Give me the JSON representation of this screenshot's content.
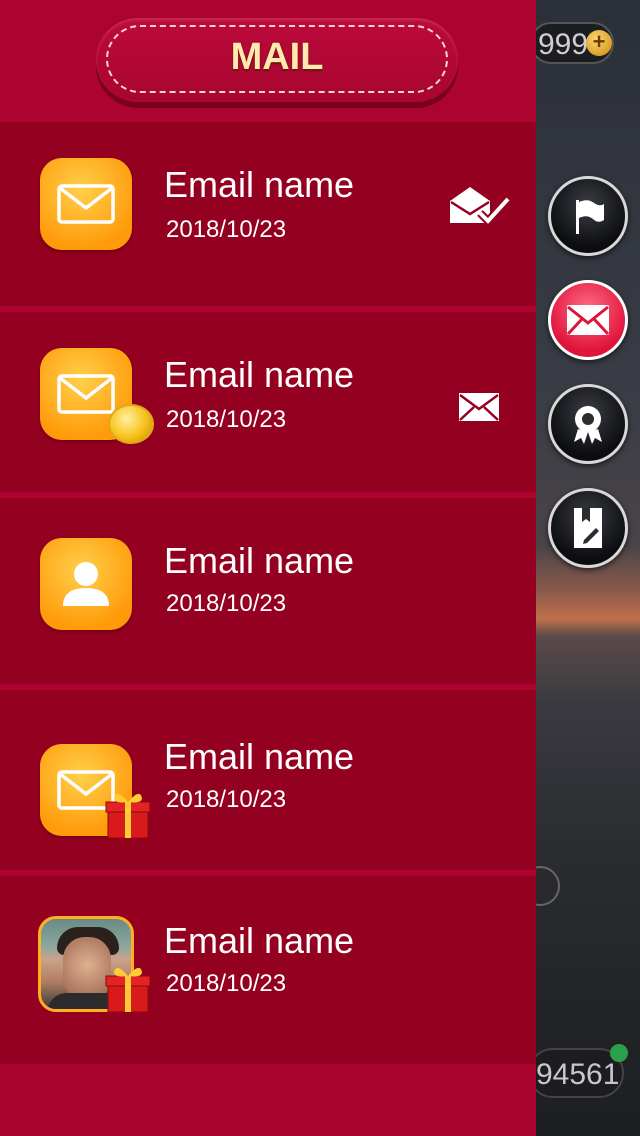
{
  "header": {
    "title": "MAIL"
  },
  "background": {
    "coin_value": "999",
    "bottom_value": "94561"
  },
  "side_buttons": [
    {
      "icon": "flag-icon",
      "active": false
    },
    {
      "icon": "mail-icon",
      "active": true
    },
    {
      "icon": "award-icon",
      "active": false
    },
    {
      "icon": "edit-icon",
      "active": false
    }
  ],
  "mails": [
    {
      "name": "Email name",
      "date": "2018/10/23",
      "icon": "envelope-icon",
      "status": "read-icon",
      "attachment": ""
    },
    {
      "name": "Email name",
      "date": "2018/10/23",
      "icon": "envelope-icon",
      "status": "unread-icon",
      "attachment": "coin-icon"
    },
    {
      "name": "Email name",
      "date": "2018/10/23",
      "icon": "user-icon",
      "status": "",
      "attachment": ""
    },
    {
      "name": "Email name",
      "date": "2018/10/23",
      "icon": "envelope-icon",
      "status": "",
      "attachment": "gift-icon"
    },
    {
      "name": "Email name",
      "date": "2018/10/23",
      "icon": "avatar",
      "status": "",
      "attachment": "gift-icon"
    }
  ],
  "colors": {
    "panel": "#a8042e",
    "row": "#94001f",
    "accent": "#ff9a0a",
    "title_text": "#ffe9b0",
    "active_button": "#e0133b"
  }
}
